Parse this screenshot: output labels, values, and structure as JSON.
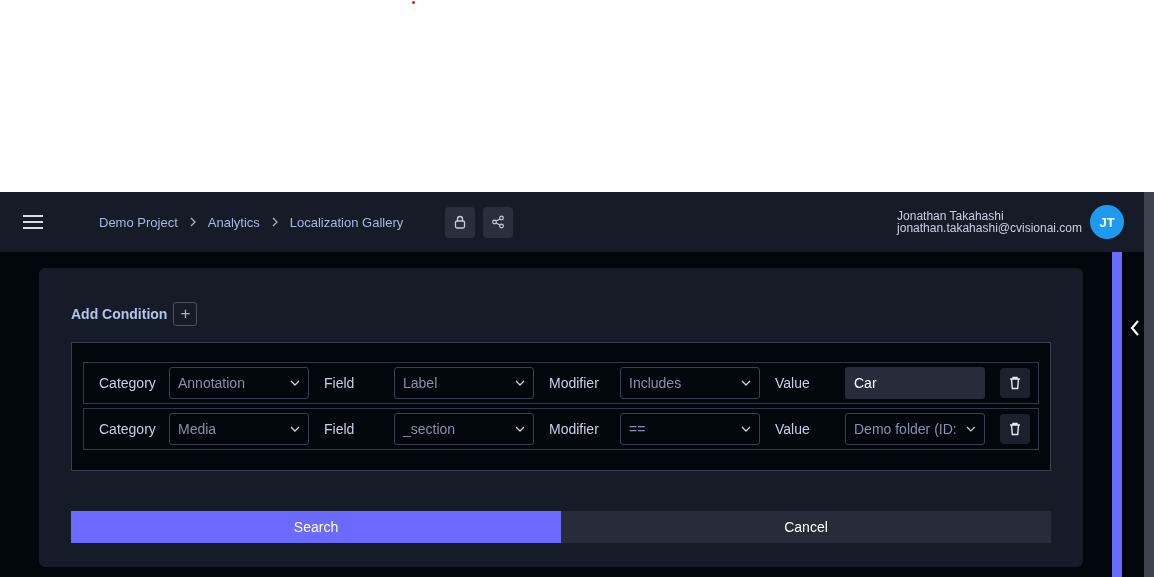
{
  "breadcrumbs": [
    {
      "label": "Demo Project"
    },
    {
      "label": "Analytics"
    },
    {
      "label": "Localization Gallery"
    }
  ],
  "user": {
    "name": "Jonathan Takahashi",
    "email": "jonathan.takahashi@cvisionai.com",
    "initials": "JT"
  },
  "add_condition": {
    "label": "Add Condition",
    "button": "+"
  },
  "conditions": [
    {
      "category_label": "Category",
      "category": "Annotation",
      "field_label": "Field",
      "field": "Label",
      "modifier_label": "Modifier",
      "modifier": "Includes",
      "value_label": "Value",
      "kind": "input",
      "value": "Car"
    },
    {
      "category_label": "Category",
      "category": "Media",
      "field_label": "Field",
      "field": "_section",
      "modifier_label": "Modifier",
      "modifier": "==",
      "value_label": "Value",
      "kind": "select",
      "value": "Demo folder (ID:"
    }
  ],
  "buttons": [
    {
      "label": "Search",
      "kind": "primary"
    },
    {
      "label": "Cancel",
      "kind": "secondary"
    }
  ]
}
